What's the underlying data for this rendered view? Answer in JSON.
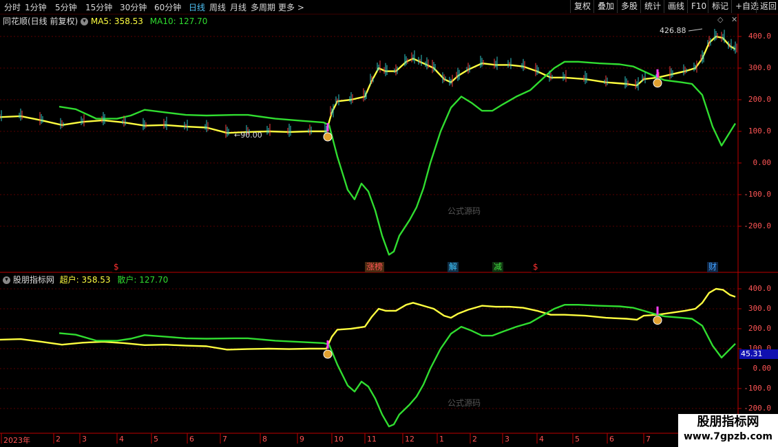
{
  "toolbar": {
    "periods": [
      "分时",
      "1分钟",
      "5分钟",
      "15分钟",
      "30分钟",
      "60分钟",
      "日线",
      "周线",
      "月线",
      "多周期",
      "更多"
    ],
    "active": "日线",
    "right": [
      "复权",
      "叠加",
      "多股",
      "统计",
      "画线",
      "F10",
      "标记",
      "+自选",
      "返回"
    ]
  },
  "main": {
    "title": "同花顺(日线 前复权)",
    "ma5_label": "MA5:",
    "ma5": "358.53",
    "ma10_label": "MA10:",
    "ma10": "127.70",
    "high_label": "426.88",
    "low_label": "90.00",
    "yticks": [
      "400.0",
      "300.0",
      "200.0",
      "100.0",
      "0.00",
      "-100.0",
      "-200.0"
    ],
    "watermark": "公式源码",
    "signals": [
      {
        "text": "$",
        "color": "#ff3030",
        "bg": "#000"
      },
      {
        "text": "涨榜",
        "color": "#ff5555",
        "bg": "#4a2a10"
      },
      {
        "text": "解",
        "color": "#40c8ff",
        "bg": "#103048"
      },
      {
        "text": "减",
        "color": "#40e040",
        "bg": "#103010"
      },
      {
        "text": "$",
        "color": "#ff3030",
        "bg": "#000"
      },
      {
        "text": "财",
        "color": "#40a0ff",
        "bg": "#102848"
      }
    ]
  },
  "sub": {
    "title": "股朋指标网",
    "a_label": "超户:",
    "a_value": "358.53",
    "b_label": "散户:",
    "b_value": "127.70",
    "yticks": [
      "400.0",
      "300.0",
      "200.0",
      "100.0",
      "0.00",
      "-100.0",
      "-200.0"
    ],
    "cursor_value": "45.31",
    "watermark": "公式源码"
  },
  "xaxis": [
    "2023年",
    "2",
    "3",
    "4",
    "5",
    "6",
    "7",
    "8",
    "9",
    "10",
    "11",
    "12",
    "1",
    "2",
    "3",
    "4",
    "5",
    "6",
    "7"
  ],
  "brand": {
    "name": "股朋指标网",
    "url": "www.7gpzb.com"
  },
  "colors": {
    "yellow": "#ffff40",
    "green": "#30dd30",
    "axis": "#c00000",
    "grid": "#5a0000"
  }
}
